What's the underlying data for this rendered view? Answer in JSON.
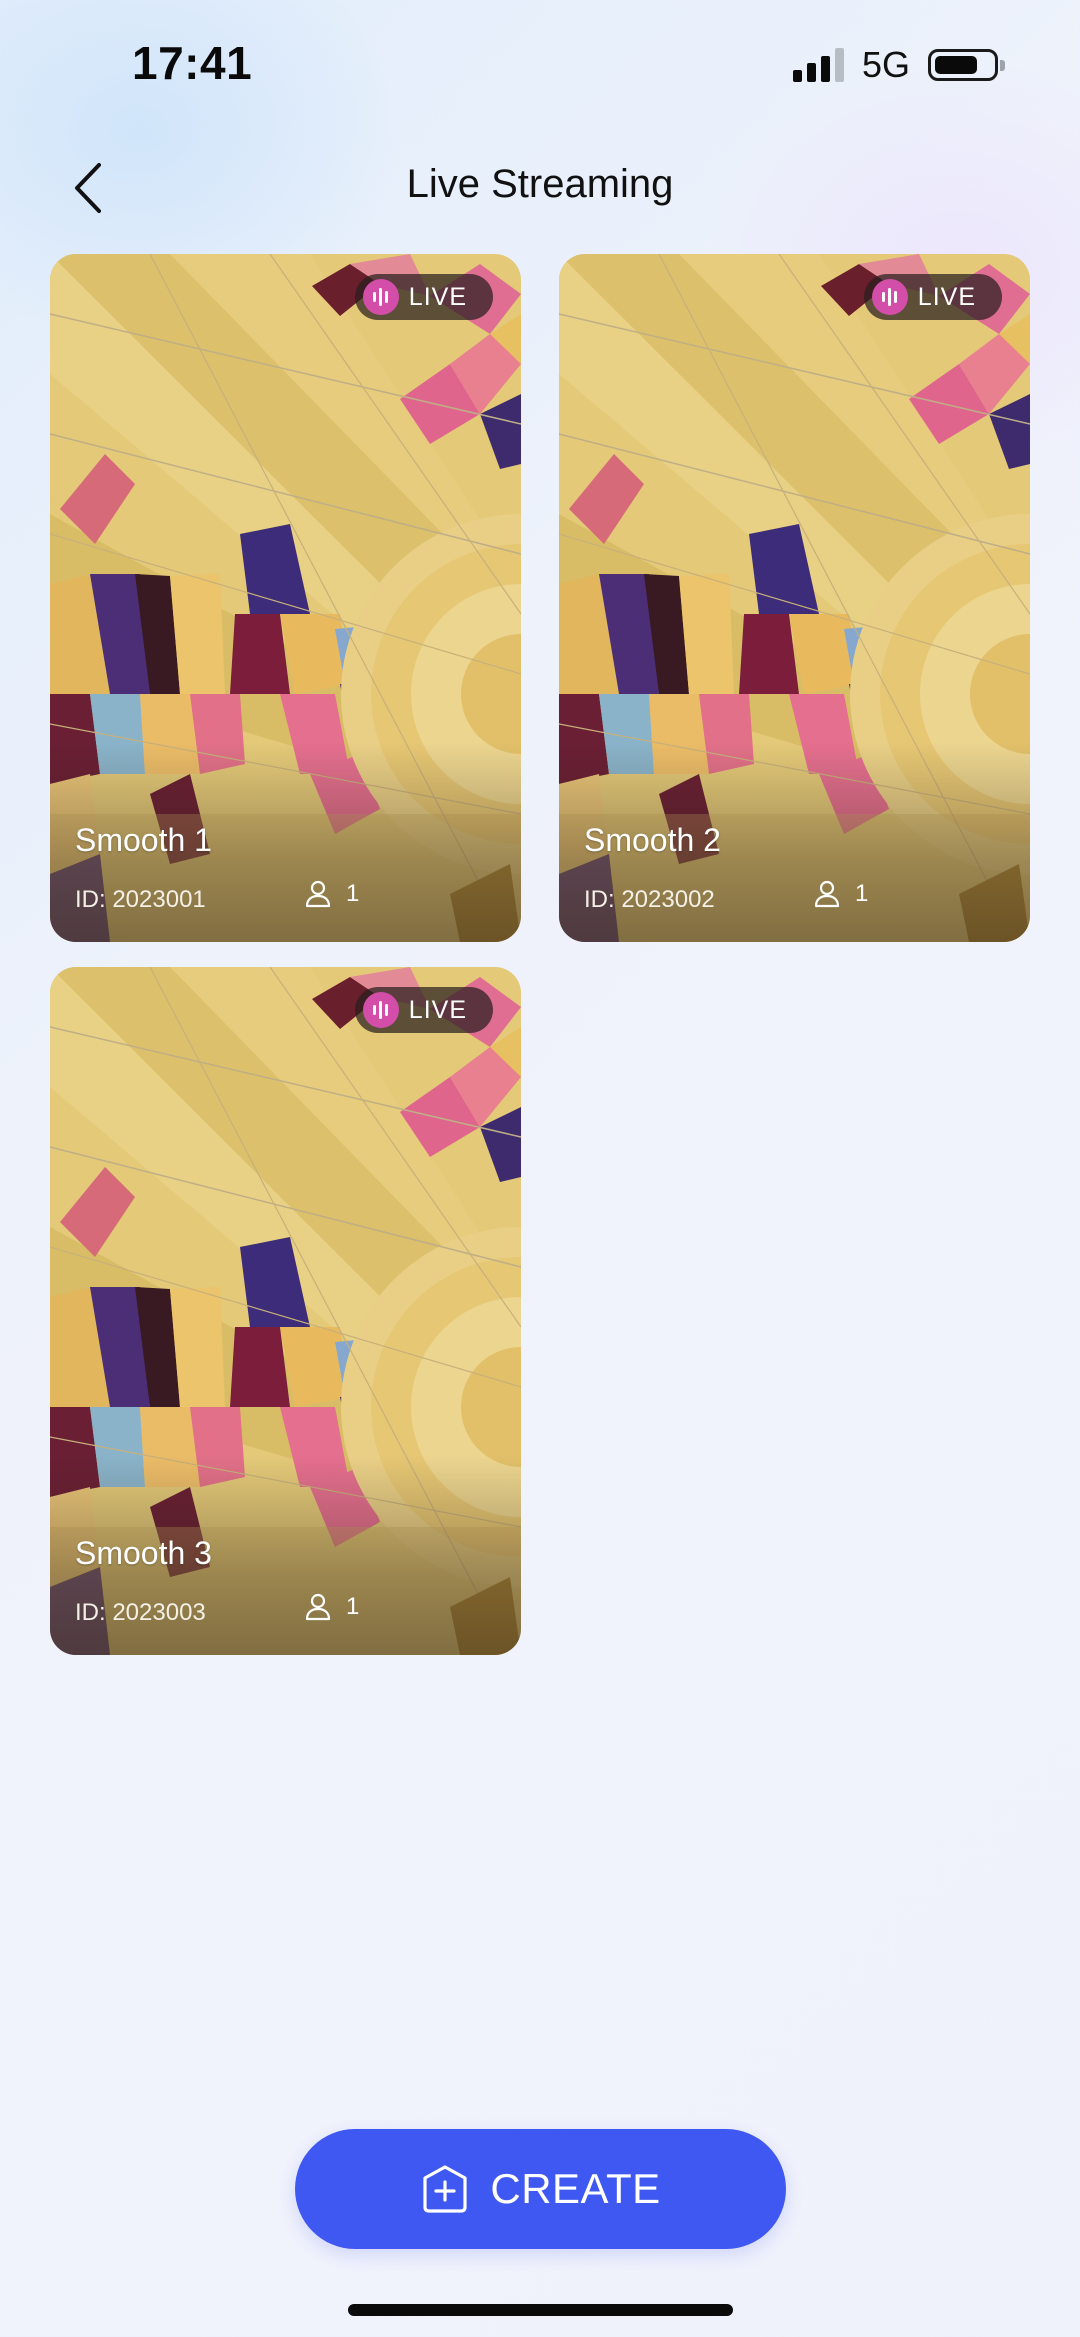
{
  "status_bar": {
    "time": "17:41",
    "network": "5G",
    "signal_bars": 4,
    "signal_active": 3,
    "battery_level": 0.66
  },
  "header": {
    "title": "Live Streaming",
    "back_icon": "chevron-left-icon"
  },
  "streams": [
    {
      "title": "Smooth 1",
      "id_label": "ID: 2023001",
      "viewers": "1",
      "badge": "LIVE"
    },
    {
      "title": "Smooth 2",
      "id_label": "ID: 2023002",
      "viewers": "1",
      "badge": "LIVE"
    },
    {
      "title": "Smooth 3",
      "id_label": "ID: 2023003",
      "viewers": "1",
      "badge": "LIVE"
    }
  ],
  "create_button": {
    "label": "CREATE",
    "icon": "add-box-icon"
  },
  "colors": {
    "accent": "#4058f2",
    "live_badge": "#d34ea8"
  }
}
